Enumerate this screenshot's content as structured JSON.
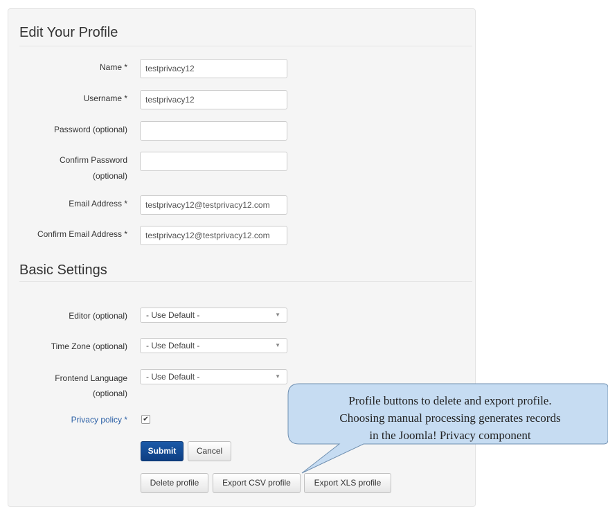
{
  "profile_section": {
    "title": "Edit Your Profile",
    "fields": [
      {
        "label": "Name *",
        "value": "testprivacy12"
      },
      {
        "label": "Username *",
        "value": "testprivacy12"
      },
      {
        "label": "Password (optional)",
        "value": ""
      },
      {
        "label_line1": "Confirm Password",
        "label_line2": "(optional)",
        "value": ""
      },
      {
        "label": "Email Address *",
        "value": "testprivacy12@testprivacy12.com"
      },
      {
        "label": "Confirm Email Address *",
        "value": "testprivacy12@testprivacy12.com"
      }
    ]
  },
  "settings_section": {
    "title": "Basic Settings",
    "fields": [
      {
        "label": "Editor (optional)",
        "value": "- Use Default -"
      },
      {
        "label": "Time Zone (optional)",
        "value": "- Use Default -"
      },
      {
        "label_line1": "Frontend Language",
        "label_line2": "(optional)",
        "value": "- Use Default -"
      }
    ]
  },
  "privacy": {
    "label": "Privacy policy *",
    "checked": true,
    "check_glyph": "✔"
  },
  "buttons": {
    "submit": "Submit",
    "cancel": "Cancel",
    "delete_profile": "Delete profile",
    "export_csv": "Export CSV profile",
    "export_xls": "Export XLS profile"
  },
  "callout": {
    "line1": "Profile buttons to delete and export profile.",
    "line2": "Choosing manual processing generates records",
    "line3": "in the Joomla! Privacy component"
  },
  "colors": {
    "panel_bg": "#f5f5f5",
    "primary_button": "#134d96",
    "callout_fill": "#c6dcf2",
    "link_label": "#2a5fa5"
  }
}
